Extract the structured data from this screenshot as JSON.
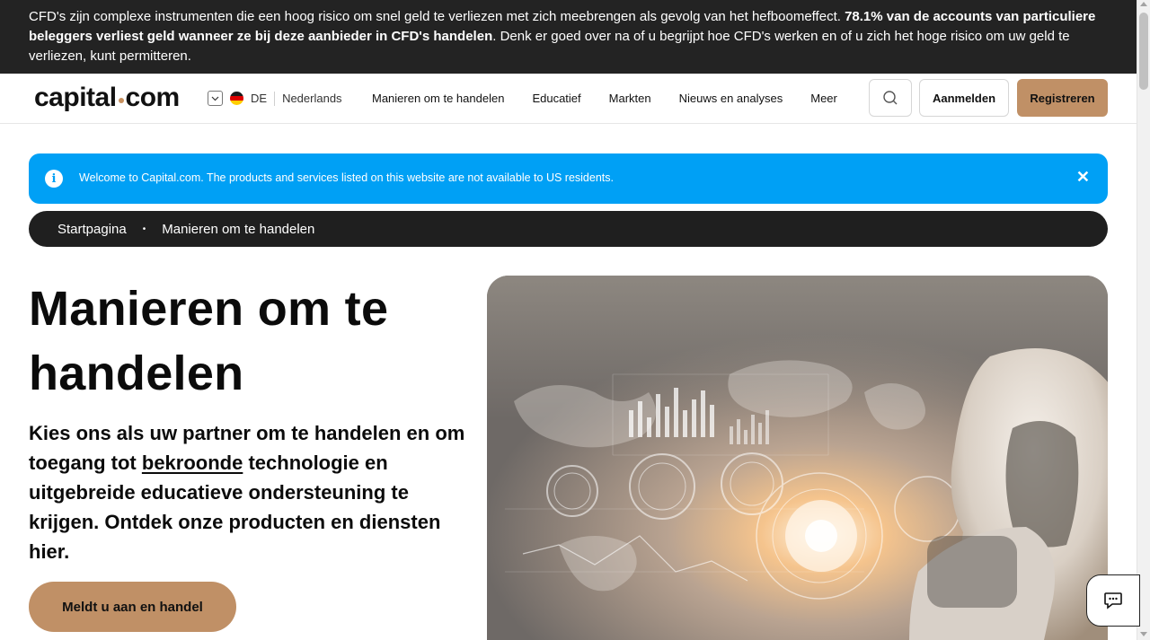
{
  "risk_banner": {
    "text_part1": "CFD's zijn complexe instrumenten die een hoog risico om snel geld te verliezen met zich meebrengen als gevolg van het hefboomeffect. ",
    "text_bold": "78.1% van de accounts van particuliere beleggers verliest geld wanneer ze bij deze aanbieder in CFD's handelen",
    "text_part2": ". Denk er goed over na of u begrijpt hoe CFD's werken en of u zich het hoge risico om uw geld te verliezen, kunt permitteren."
  },
  "header": {
    "logo_left": "capital",
    "logo_right": "com",
    "lang_code": "DE",
    "language": "Nederlands",
    "nav": [
      "Manieren om te handelen",
      "Educatief",
      "Markten",
      "Nieuws en analyses",
      "Meer"
    ],
    "login_label": "Aanmelden",
    "register_label": "Registreren",
    "icons": {
      "search": "search-icon",
      "chevron": "chevron-down-icon",
      "flag": "flag-de-icon"
    }
  },
  "info_banner": {
    "text": "Welcome to Capital.com. The products and services listed on this website are not available to US residents.",
    "icon": "i",
    "close": "✕",
    "color": "#00a0f5"
  },
  "breadcrumb": {
    "items": [
      "Startpagina",
      "Manieren om te handelen"
    ],
    "separator": "•"
  },
  "hero": {
    "title": "Manieren om te handelen",
    "subtitle_part1": "Kies ons als uw partner om te handelen en om toegang tot ",
    "subtitle_link": "bekroonde",
    "subtitle_part2": " technologie en uitgebreide educatieve ondersteuning te krijgen. Ontdek onze producten en diensten hier.",
    "cta_label": "Meldt u aan en handel",
    "accent": "#c09066"
  },
  "chat": {
    "icon": "chat-icon"
  }
}
